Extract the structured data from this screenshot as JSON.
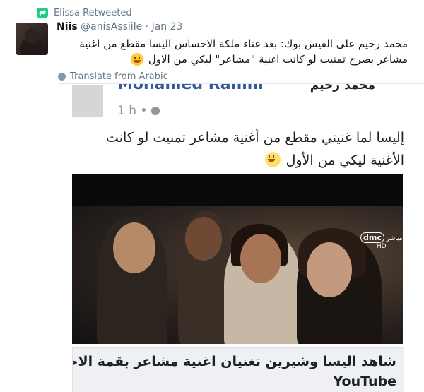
{
  "retweet": {
    "label": "Elissa Retweeted",
    "icon": "retweet-icon",
    "accent": "#19cf86"
  },
  "tweet": {
    "author_name": "Niis",
    "author_handle": "@anisAssiile",
    "separator": "·",
    "date": "Jan 23",
    "text": "محمد رحيم على الفيس بوك: بعد غناء ملكة الاحساس اليسا مقطع من اغنية مشاعر يصرح تمنيت لو كانت اغنية \"مشاعر\" ليكي من الاول",
    "translate_label": "Translate from Arabic"
  },
  "embedded_post": {
    "author_name_en": "Mohamed Rahim",
    "author_name_ar": "محمد رحيم",
    "time": "1 h",
    "time_dot": "•",
    "text": "إليسا لما غنيتي مقطع من أغنية مشاعر تمنيت لو كانت الأغنية ليكي من الأول",
    "photo_badge": {
      "logo": "dmc",
      "label": "مباشر",
      "hd": "HD"
    },
    "caption_title": "شاهد اليسا وشيرين تغنيان اغنية مشاعر بقمة الاحساس في",
    "caption_subtitle": "YouTube"
  }
}
